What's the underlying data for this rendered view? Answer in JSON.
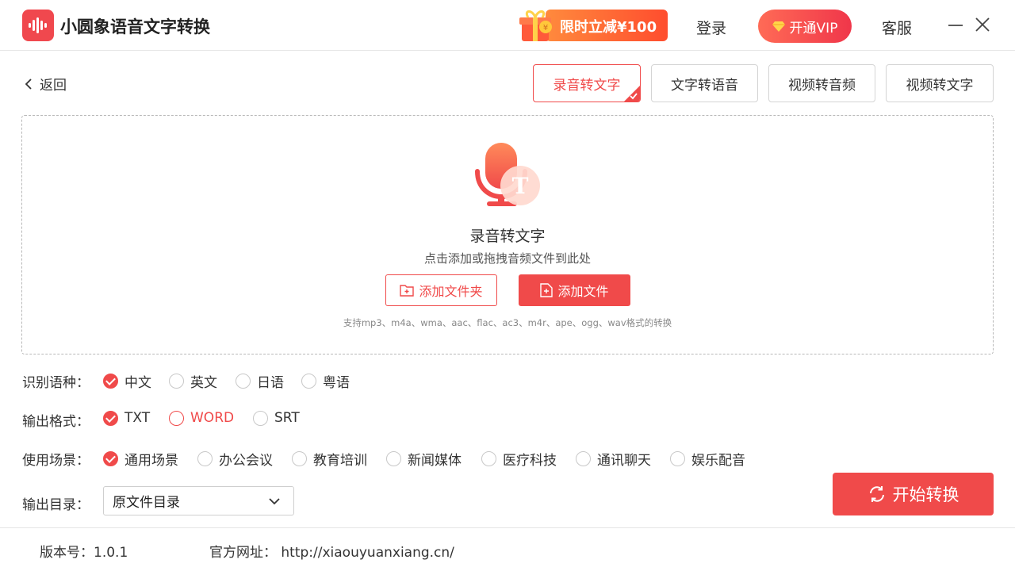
{
  "header": {
    "app_name": "小圆象语音文字转换",
    "promo_label": "限时立减¥100",
    "login_label": "登录",
    "vip_label": "开通VIP",
    "service_label": "客服"
  },
  "nav": {
    "back_label": "返回",
    "tabs": [
      {
        "label": "录音转文字",
        "active": true
      },
      {
        "label": "文字转语音",
        "active": false
      },
      {
        "label": "视频转音频",
        "active": false
      },
      {
        "label": "视频转文字",
        "active": false
      }
    ]
  },
  "dropzone": {
    "title": "录音转文字",
    "subtitle": "点击添加或拖拽音频文件到此处",
    "add_folder_label": "添加文件夹",
    "add_file_label": "添加文件",
    "formats_note": "支持mp3、m4a、wma、aac、flac、ac3、m4r、ape、ogg、wav格式的转换"
  },
  "options": {
    "language": {
      "label": "识别语种：",
      "items": [
        "中文",
        "英文",
        "日语",
        "粤语"
      ],
      "selected": "中文"
    },
    "format": {
      "label": "输出格式：",
      "items": [
        "TXT",
        "WORD",
        "SRT"
      ],
      "selected": "TXT",
      "hovered": "WORD"
    },
    "scene": {
      "label": "使用场景：",
      "items": [
        "通用场景",
        "办公会议",
        "教育培训",
        "新闻媒体",
        "医疗科技",
        "通讯聊天",
        "娱乐配音"
      ],
      "selected": "通用场景"
    },
    "output_dir": {
      "label": "输出目录：",
      "value": "原文件目录"
    }
  },
  "start_label": "开始转换",
  "footer": {
    "version": "版本号：1.0.1",
    "website": "官方网址：  http://xiaouyuanxiang.cn/"
  },
  "colors": {
    "accent": "#f04a4a",
    "promo": "#ff6a3a"
  }
}
